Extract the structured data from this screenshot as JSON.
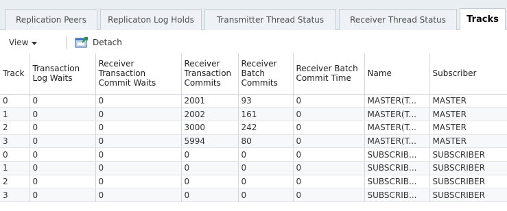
{
  "tabs": [
    {
      "label": "Replication Peers",
      "active": false
    },
    {
      "label": "Replicaton Log Holds",
      "active": false
    },
    {
      "label": "Transmitter Thread Status",
      "active": false
    },
    {
      "label": "Receiver Thread Status",
      "active": false
    },
    {
      "label": "Tracks",
      "active": true
    }
  ],
  "toolbar": {
    "view_label": "View",
    "detach_label": "Detach"
  },
  "table": {
    "columns": [
      "Track",
      "Transaction Log Waits",
      "Receiver Transaction Commit Waits",
      "Receiver Transaction Commits",
      "Receiver Batch Commits",
      "Receiver Batch Commit Time",
      "Name",
      "Subscriber"
    ],
    "rows": [
      [
        "0",
        "0",
        "0",
        "2001",
        "93",
        "0",
        "MASTER(T...",
        "MASTER"
      ],
      [
        "1",
        "0",
        "0",
        "2002",
        "161",
        "0",
        "MASTER(T...",
        "MASTER"
      ],
      [
        "2",
        "0",
        "0",
        "3000",
        "242",
        "0",
        "MASTER(T...",
        "MASTER"
      ],
      [
        "3",
        "0",
        "0",
        "5994",
        "80",
        "0",
        "MASTER(T...",
        "MASTER"
      ],
      [
        "0",
        "0",
        "0",
        "0",
        "0",
        "0",
        "SUBSCRIB...",
        "SUBSCRIBER"
      ],
      [
        "1",
        "0",
        "0",
        "0",
        "0",
        "0",
        "SUBSCRIB...",
        "SUBSCRIBER"
      ],
      [
        "2",
        "0",
        "0",
        "0",
        "0",
        "0",
        "SUBSCRIB...",
        "SUBSCRIBER"
      ],
      [
        "3",
        "0",
        "0",
        "0",
        "0",
        "0",
        "SUBSCRIB...",
        "SUBSCRIBER"
      ]
    ]
  },
  "colors": {
    "tab_bar_bg": "#e9eef3",
    "border": "#c4ced7",
    "alt_row": "#f7f8fa",
    "active_tab_bg": "#ffffff"
  },
  "icons": {
    "view_menu": "chevron-down-icon",
    "detach": "detach-icon"
  }
}
